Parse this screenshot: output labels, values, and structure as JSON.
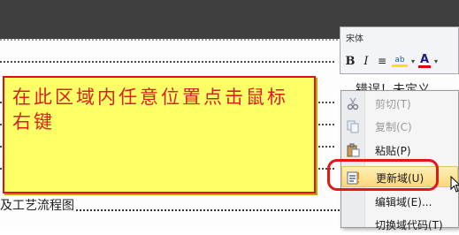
{
  "callout": {
    "text": "在此区域内任意位置点击鼠标右键"
  },
  "document": {
    "toc_text": "及工艺流程图",
    "right_text": "错误！未定义"
  },
  "mini_toolbar": {
    "font_label": "宋体",
    "bold": "B",
    "italic": "I",
    "align": "≡",
    "highlight": "ab",
    "font_color": "A",
    "dropdown": "▾"
  },
  "context_menu": {
    "items": [
      {
        "label": "剪切(T)",
        "enabled": false,
        "icon": "scissors-icon"
      },
      {
        "label": "复制(C)",
        "enabled": false,
        "icon": "copy-icon"
      },
      {
        "label": "粘贴(P)",
        "enabled": true,
        "icon": "paste-icon"
      },
      {
        "label": "更新域(U)",
        "enabled": true,
        "icon": "update-field-icon",
        "highlighted": true
      },
      {
        "label": "编辑域(E)...",
        "enabled": true,
        "icon": ""
      },
      {
        "label": "切换域代码(T)",
        "enabled": true,
        "icon": ""
      }
    ]
  },
  "colors": {
    "callout_bg": "#ffff66",
    "callout_border": "#e01010",
    "callout_text": "#d82020",
    "highlight_ring": "#e01818",
    "menu_highlight": "#fbd97a"
  }
}
